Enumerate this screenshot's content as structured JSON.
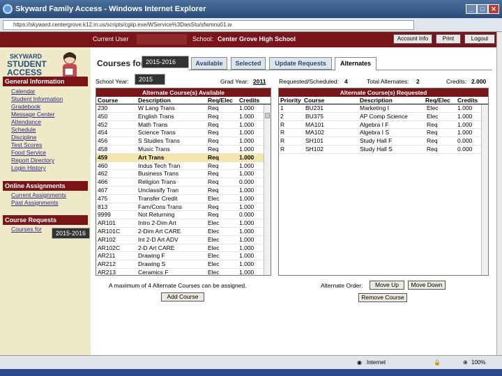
{
  "window": {
    "title": "Skyward Family Access - Windows Internet Explorer"
  },
  "browser": {
    "url": "https://skyward.centergrove.k12.in.us/scripts/cgiip.exe/WService%3DwsStu/sfwmnu01.w"
  },
  "header": {
    "user_label": "Current User",
    "school_label": "School:",
    "school_name": "Center Grove High School",
    "buttons": [
      "Account Info",
      "Print",
      "Logout"
    ]
  },
  "sidebar": {
    "logo_top": "SKYWARD",
    "logo_line1": "STUDENT",
    "logo_line2": "ACCESS",
    "sections": [
      {
        "title": "General Information",
        "items": [
          "Calendar",
          "Student Information",
          "Gradebook",
          "Message Center",
          "Attendance",
          "Schedule",
          "Discipline",
          "Test Scores",
          "Food Service",
          "Report Directory",
          "Login History"
        ]
      },
      {
        "title": "Online Assignments",
        "items": [
          "Current Assignments",
          "Past Assignments"
        ]
      },
      {
        "title": "Course Requests",
        "items": [
          "Courses for"
        ]
      }
    ],
    "year_overlay": "2015-2016"
  },
  "main": {
    "title": "Courses for",
    "title_year": "2015-2016",
    "tabs": [
      "Available",
      "Selected",
      "Update Requests",
      "Alternates"
    ],
    "school_year_label": "School Year:",
    "school_year_value": "2015",
    "grad_year_label": "Grad Year:",
    "grad_year_value": "2011",
    "requested_label": "Requested/Scheduled:",
    "requested_value": "4",
    "total_alt_label": "Total Alternates:",
    "total_alt_value": "2",
    "credits_label": "Credits:",
    "credits_value": "2.000"
  },
  "available": {
    "title": "Alternate Course(s) Available",
    "columns": [
      "Course",
      "Description",
      "Req/Elec",
      "Credits"
    ],
    "rows": [
      [
        "230",
        "W Lang Trans",
        "Req",
        "1.000"
      ],
      [
        "450",
        "English Trans",
        "Req",
        "1.000"
      ],
      [
        "452",
        "Math Trans",
        "Req",
        "1.000"
      ],
      [
        "454",
        "Science Trans",
        "Req",
        "1.000"
      ],
      [
        "456",
        "S Studies Trans",
        "Req",
        "1.000"
      ],
      [
        "458",
        "Music Trans",
        "Req",
        "1.000"
      ],
      [
        "459",
        "Art Trans",
        "Req",
        "1.000"
      ],
      [
        "460",
        "Indus Tech Tran",
        "Req",
        "1.000"
      ],
      [
        "462",
        "Business Trans",
        "Req",
        "1.000"
      ],
      [
        "466",
        "Religion Trans",
        "Req",
        "0.000"
      ],
      [
        "467",
        "Unclassify Tran",
        "Req",
        "1.000"
      ],
      [
        "475",
        "Transfer Credit",
        "Elec",
        "1.000"
      ],
      [
        "813",
        "Fam/Cons Trans",
        "Req",
        "1.000"
      ],
      [
        "9999",
        "Not Returning",
        "Req",
        "0.000"
      ],
      [
        "AR101",
        "Intro 2-Dim Art",
        "Elec",
        "1.000"
      ],
      [
        "AR101C",
        "2-Dim Art CARE",
        "Elec",
        "1.000"
      ],
      [
        "AR102",
        "Int 2-D Art ADV",
        "Elec",
        "1.000"
      ],
      [
        "AR102C",
        "2-D Art CARE",
        "Elec",
        "1.000"
      ],
      [
        "AR211",
        "Drawing F",
        "Elec",
        "1.000"
      ],
      [
        "AR212",
        "Drawing S",
        "Elec",
        "1.000"
      ],
      [
        "AR213",
        "Ceramics F",
        "Elec",
        "1.000"
      ]
    ],
    "selected_index": 6,
    "note": "A maximum of 4 Alternate Courses can be assigned.",
    "add_button": "Add Course"
  },
  "requested": {
    "title": "Alternate Course(s) Requested",
    "columns": [
      "Priority",
      "Course",
      "Description",
      "Req/Elec",
      "Credits"
    ],
    "rows": [
      [
        "1",
        "BU231",
        "Marketing I",
        "Elec",
        "1.000"
      ],
      [
        "2",
        "BU375",
        "AP Comp Science",
        "Elec",
        "1.000"
      ],
      [
        "R",
        "MA101",
        "Algebra I F",
        "Req",
        "1.000"
      ],
      [
        "R",
        "MA102",
        "Algebra I S",
        "Req",
        "1.000"
      ],
      [
        "R",
        "SH101",
        "Study Hall F",
        "Req",
        "0.000"
      ],
      [
        "R",
        "SH102",
        "Study Hall S",
        "Req",
        "0.000"
      ]
    ],
    "order_label": "Alternate Order:",
    "move_up": "Move Up",
    "move_down": "Move Down",
    "remove": "Remove Course"
  },
  "status": {
    "zone": "Internet",
    "zoom": "100%"
  }
}
